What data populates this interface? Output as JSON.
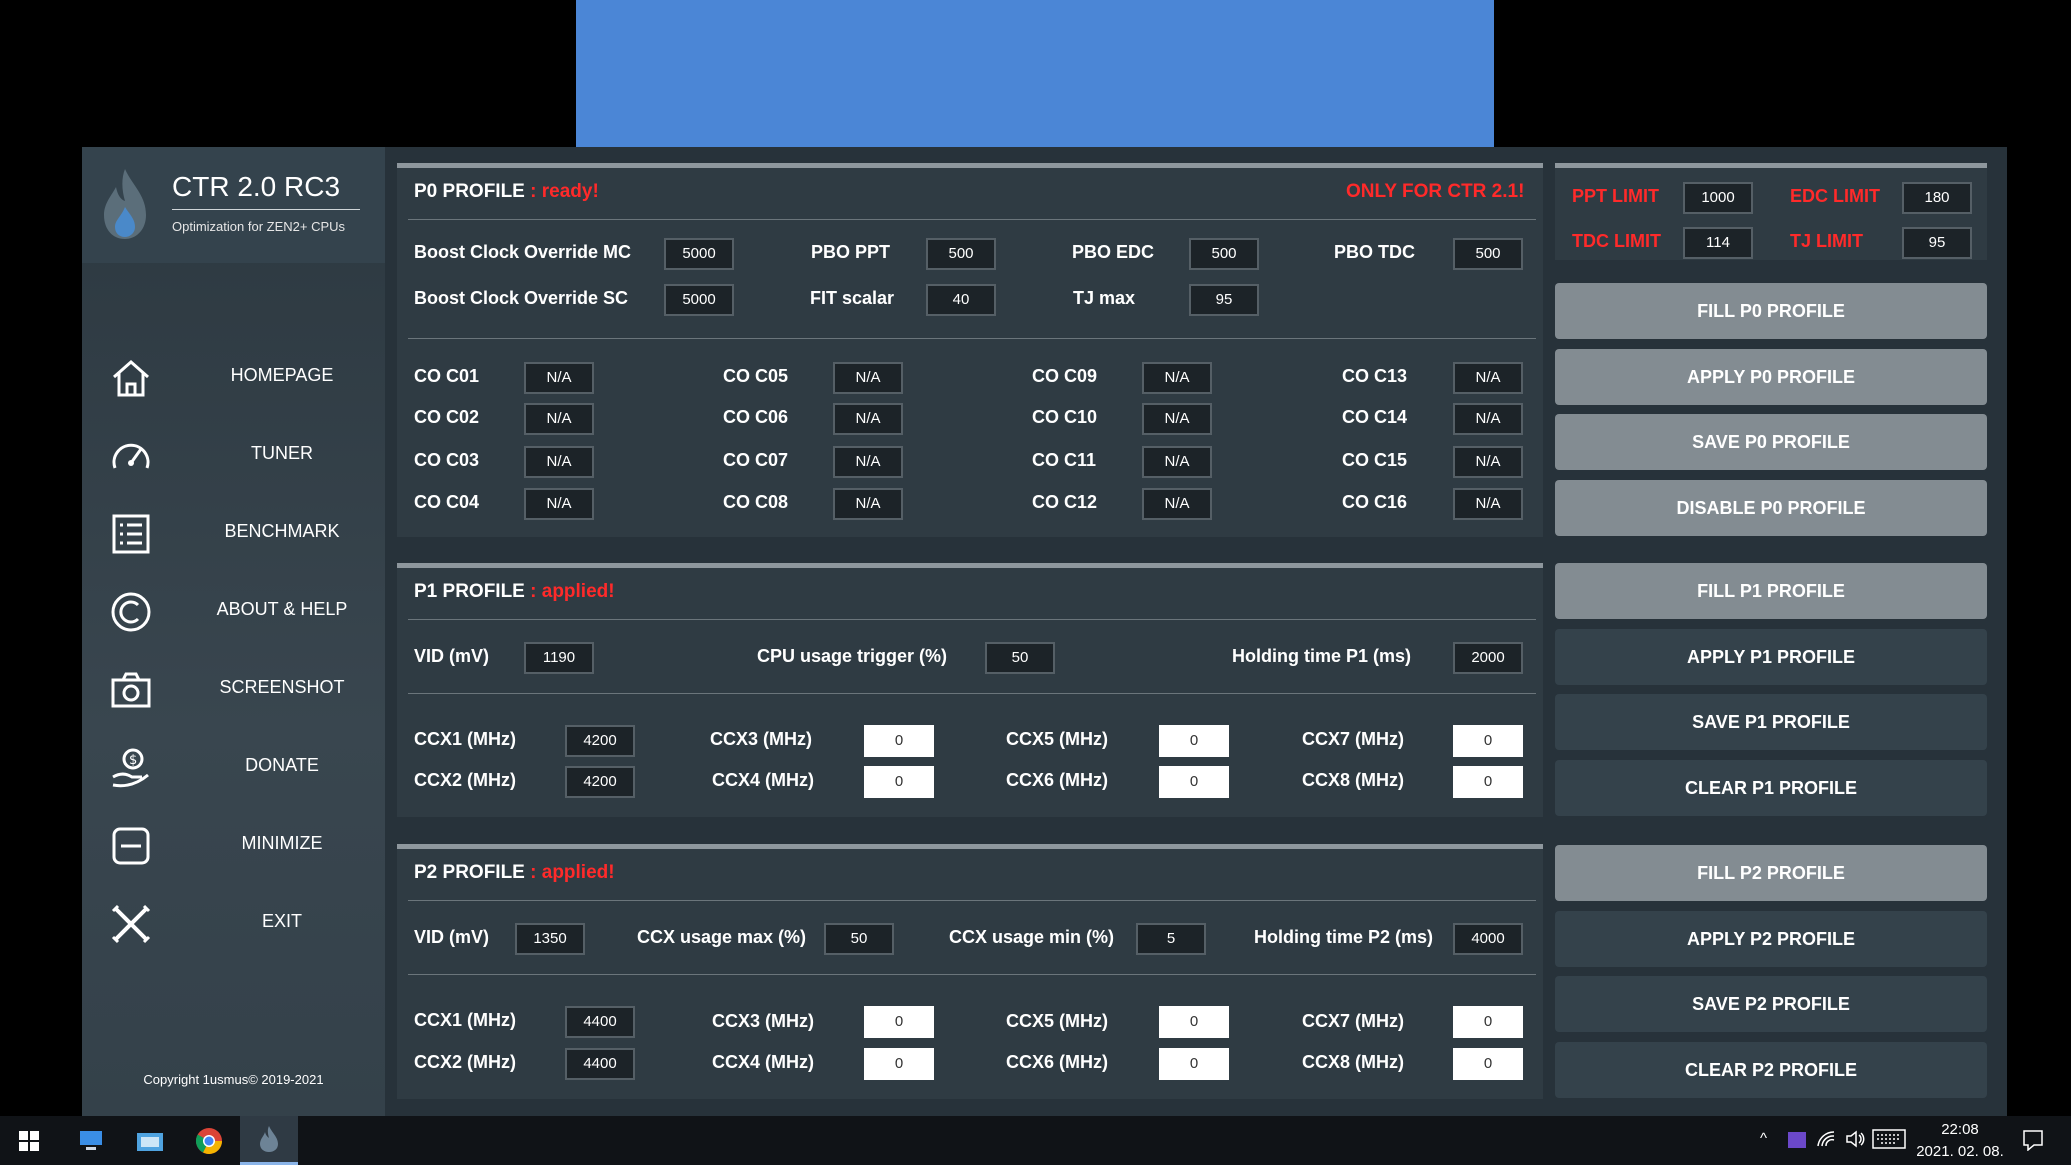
{
  "app": {
    "title": "CTR 2.0 RC3",
    "subtitle": "Optimization for ZEN2+ CPUs",
    "copyright": "Copyright 1usmus© 2019-2021"
  },
  "nav": [
    {
      "label": "HOMEPAGE",
      "icon": "home-icon"
    },
    {
      "label": "TUNER",
      "icon": "speedometer-icon"
    },
    {
      "label": "BENCHMARK",
      "icon": "list-icon"
    },
    {
      "label": "ABOUT & HELP",
      "icon": "copyright-icon"
    },
    {
      "label": "SCREENSHOT",
      "icon": "camera-icon"
    },
    {
      "label": "DONATE",
      "icon": "donate-icon"
    },
    {
      "label": "MINIMIZE",
      "icon": "minimize-icon"
    },
    {
      "label": "EXIT",
      "icon": "exit-icon"
    }
  ],
  "p0": {
    "title": "P0 PROFILE",
    "status": ": ready!",
    "notice": "ONLY FOR CTR 2.1!",
    "boost_mc": {
      "label": "Boost Clock Override MC",
      "value": "5000"
    },
    "boost_sc": {
      "label": "Boost Clock Override SC",
      "value": "5000"
    },
    "pbo_ppt": {
      "label": "PBO PPT",
      "value": "500"
    },
    "fit": {
      "label": "FIT scalar",
      "value": "40"
    },
    "pbo_edc": {
      "label": "PBO EDC",
      "value": "500"
    },
    "tjmax": {
      "label": "TJ max",
      "value": "95"
    },
    "pbo_tdc": {
      "label": "PBO TDC",
      "value": "500"
    },
    "co": [
      {
        "label": "CO C01",
        "value": "N/A"
      },
      {
        "label": "CO C02",
        "value": "N/A"
      },
      {
        "label": "CO C03",
        "value": "N/A"
      },
      {
        "label": "CO C04",
        "value": "N/A"
      },
      {
        "label": "CO C05",
        "value": "N/A"
      },
      {
        "label": "CO C06",
        "value": "N/A"
      },
      {
        "label": "CO C07",
        "value": "N/A"
      },
      {
        "label": "CO C08",
        "value": "N/A"
      },
      {
        "label": "CO C09",
        "value": "N/A"
      },
      {
        "label": "CO C10",
        "value": "N/A"
      },
      {
        "label": "CO C11",
        "value": "N/A"
      },
      {
        "label": "CO C12",
        "value": "N/A"
      },
      {
        "label": "CO C13",
        "value": "N/A"
      },
      {
        "label": "CO C14",
        "value": "N/A"
      },
      {
        "label": "CO C15",
        "value": "N/A"
      },
      {
        "label": "CO C16",
        "value": "N/A"
      }
    ]
  },
  "p1": {
    "title": "P1 PROFILE",
    "status": ": applied!",
    "vid": {
      "label": "VID (mV)",
      "value": "1190"
    },
    "trigger": {
      "label": "CPU usage trigger (%)",
      "value": "50"
    },
    "hold": {
      "label": "Holding time P1 (ms)",
      "value": "2000"
    },
    "ccx": [
      {
        "label": "CCX1 (MHz)",
        "value": "4200"
      },
      {
        "label": "CCX2 (MHz)",
        "value": "4200"
      },
      {
        "label": "CCX3 (MHz)",
        "value": "0"
      },
      {
        "label": "CCX4 (MHz)",
        "value": "0"
      },
      {
        "label": "CCX5 (MHz)",
        "value": "0"
      },
      {
        "label": "CCX6 (MHz)",
        "value": "0"
      },
      {
        "label": "CCX7 (MHz)",
        "value": "0"
      },
      {
        "label": "CCX8 (MHz)",
        "value": "0"
      }
    ]
  },
  "p2": {
    "title": "P2 PROFILE",
    "status": ": applied!",
    "vid": {
      "label": "VID (mV)",
      "value": "1350"
    },
    "max": {
      "label": "CCX usage max (%)",
      "value": "50"
    },
    "min": {
      "label": "CCX usage min (%)",
      "value": "5"
    },
    "hold": {
      "label": "Holding time P2 (ms)",
      "value": "4000"
    },
    "ccx": [
      {
        "label": "CCX1 (MHz)",
        "value": "4400"
      },
      {
        "label": "CCX2 (MHz)",
        "value": "4400"
      },
      {
        "label": "CCX3 (MHz)",
        "value": "0"
      },
      {
        "label": "CCX4 (MHz)",
        "value": "0"
      },
      {
        "label": "CCX5 (MHz)",
        "value": "0"
      },
      {
        "label": "CCX6 (MHz)",
        "value": "0"
      },
      {
        "label": "CCX7 (MHz)",
        "value": "0"
      },
      {
        "label": "CCX8 (MHz)",
        "value": "0"
      }
    ]
  },
  "limits": {
    "ppt": {
      "label": "PPT LIMIT",
      "value": "1000"
    },
    "edc": {
      "label": "EDC LIMIT",
      "value": "180"
    },
    "tdc": {
      "label": "TDC LIMIT",
      "value": "114"
    },
    "tj": {
      "label": "TJ LIMIT",
      "value": "95"
    }
  },
  "buttons": {
    "fill_p0": "FILL P0 PROFILE",
    "apply_p0": "APPLY P0 PROFILE",
    "save_p0": "SAVE P0 PROFILE",
    "disable_p0": "DISABLE P0 PROFILE",
    "fill_p1": "FILL P1 PROFILE",
    "apply_p1": "APPLY P1 PROFILE",
    "save_p1": "SAVE P1 PROFILE",
    "clear_p1": "CLEAR P1 PROFILE",
    "fill_p2": "FILL P2 PROFILE",
    "apply_p2": "APPLY P2 PROFILE",
    "save_p2": "SAVE P2 PROFILE",
    "clear_p2": "CLEAR P2 PROFILE"
  },
  "taskbar": {
    "time": "22:08",
    "date": "2021. 02. 08."
  },
  "colors": {
    "status_red": "#ff2a2a",
    "button_light": "#838c92",
    "button_dark": "#34424b",
    "panel": "#2f3b43"
  }
}
